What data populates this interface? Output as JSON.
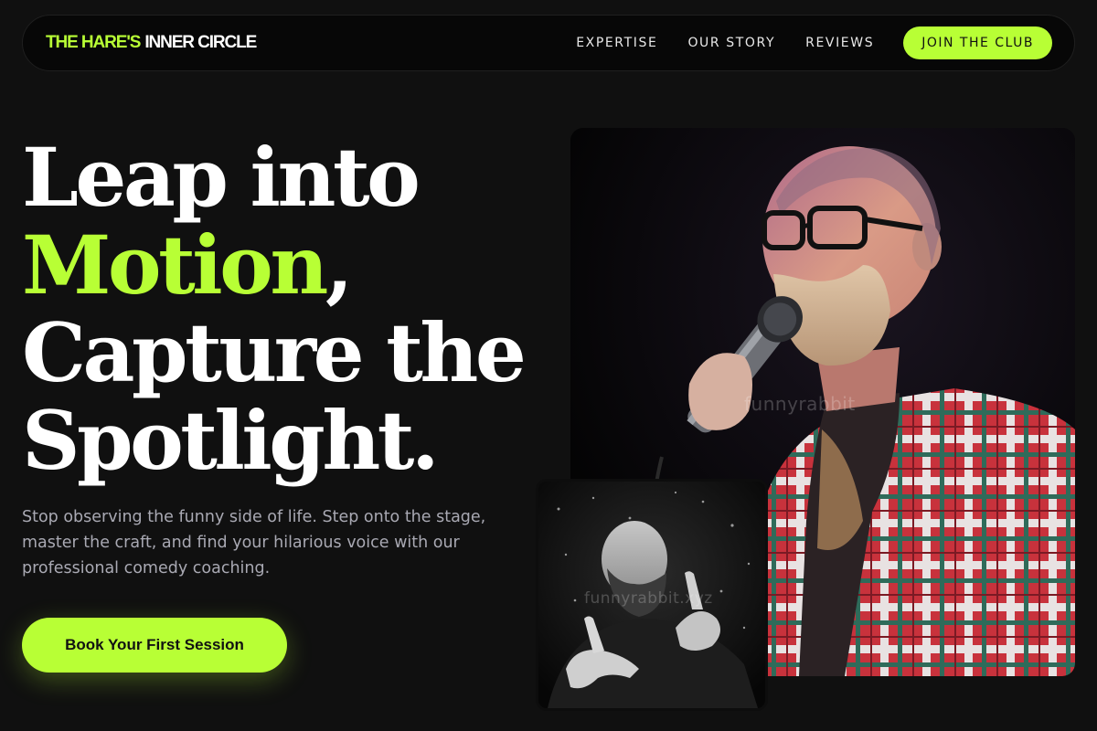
{
  "nav": {
    "logo_accent": "THE HARE'S",
    "logo_plain": "INNER CIRCLE",
    "links": [
      "EXPERTISE",
      "OUR STORY",
      "REVIEWS"
    ],
    "cta_label": "JOIN THE CLUB"
  },
  "hero": {
    "line1": "Leap into",
    "line2_accent": "Motion",
    "line2_rest": ",",
    "line3": "Capture the",
    "line4": "Spotlight.",
    "subtext": "Stop observing the funny side of life. Step onto the stage, master the craft, and find your hilarious voice with our professional comedy coaching.",
    "cta_label": "Book Your First Session"
  },
  "images": {
    "main_watermark": "funnyrabbit",
    "small_watermark": "funnyrabbit.xyz"
  },
  "colors": {
    "accent": "#b8ff35",
    "background": "#101010",
    "text_muted": "#a9a9b3"
  }
}
